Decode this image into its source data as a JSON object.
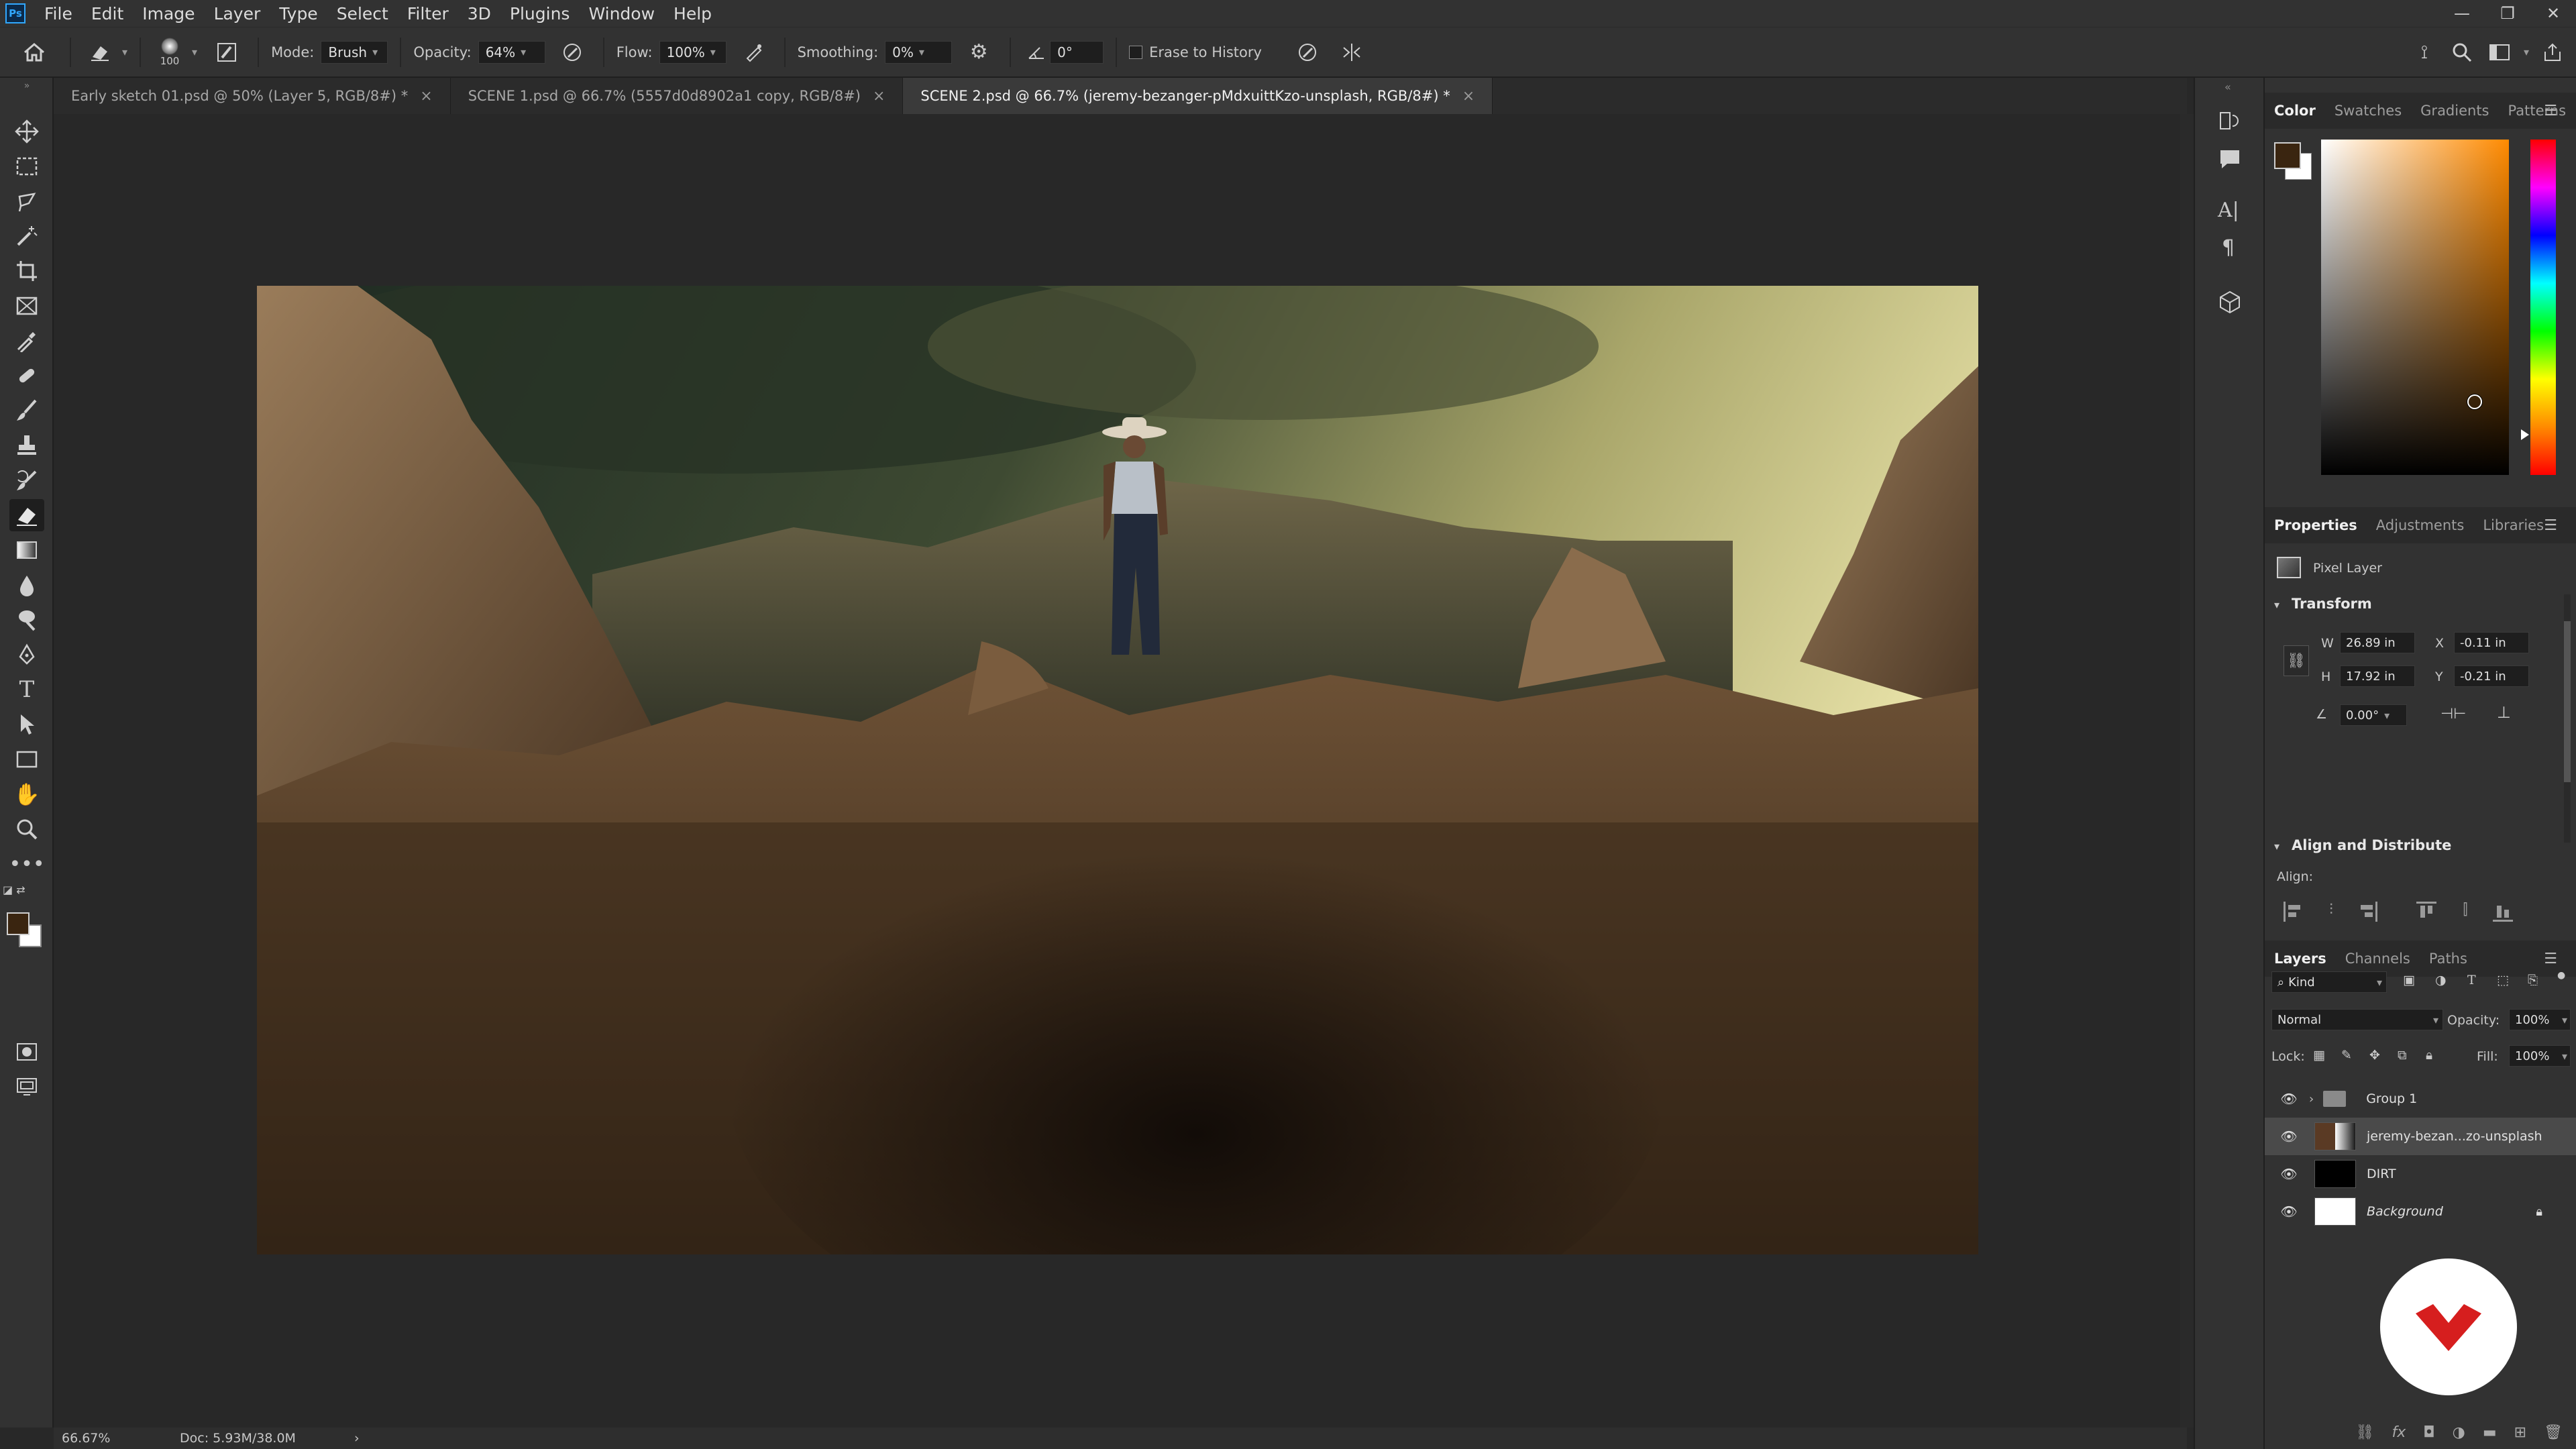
{
  "menubar": {
    "app_icon": "Ps",
    "items": [
      "File",
      "Edit",
      "Image",
      "Layer",
      "Type",
      "Select",
      "Filter",
      "3D",
      "Plugins",
      "Window",
      "Help"
    ],
    "window_controls": [
      "minimize-icon",
      "restore-icon",
      "close-icon"
    ]
  },
  "options": {
    "brush_size": "100",
    "mode_label": "Mode:",
    "mode_value": "Brush",
    "opacity_label": "Opacity:",
    "opacity_value": "64%",
    "flow_label": "Flow:",
    "flow_value": "100%",
    "smoothing_label": "Smoothing:",
    "smoothing_value": "0%",
    "angle_value": "0°",
    "erase_history_label": "Erase to History"
  },
  "tabs": [
    {
      "label": "Early sketch 01.psd @ 50% (Layer 5, RGB/8#) *",
      "active": false
    },
    {
      "label": "SCENE 1.psd @ 66.7% (5557d0d8902a1 copy, RGB/8#)",
      "active": false
    },
    {
      "label": "SCENE 2.psd @ 66.7% (jeremy-bezanger-pMdxuittKzo-unsplash, RGB/8#) *",
      "active": true
    }
  ],
  "status": {
    "zoom": "66.67%",
    "doc": "Doc: 5.93M/38.0M",
    "arrow": "›"
  },
  "color_panel": {
    "tabs": [
      "Color",
      "Swatches",
      "Gradients",
      "Patterns"
    ],
    "foreground": "#3a2510",
    "background": "#ffffff",
    "hue_color": "#ff8a00"
  },
  "properties_panel": {
    "tabs": [
      "Properties",
      "Adjustments",
      "Libraries"
    ],
    "layer_type": "Pixel Layer",
    "transform_title": "Transform",
    "w_label": "W",
    "w_value": "26.89 in",
    "h_label": "H",
    "h_value": "17.92 in",
    "x_label": "X",
    "x_value": "-0.11 in",
    "y_label": "Y",
    "y_value": "-0.21 in",
    "angle_value": "0.00°",
    "align_title": "Align and Distribute",
    "align_label": "Align:",
    "more": "..."
  },
  "layers_panel": {
    "tabs": [
      "Layers",
      "Channels",
      "Paths"
    ],
    "filter_kind": "Kind",
    "blend_mode": "Normal",
    "opacity_label": "Opacity:",
    "opacity_value": "100%",
    "lock_label": "Lock:",
    "fill_label": "Fill:",
    "fill_value": "100%",
    "layers": [
      {
        "name": "Group 1",
        "type": "group"
      },
      {
        "name": "jeremy-bezan...zo-unsplash",
        "type": "pixel",
        "selected": true
      },
      {
        "name": "DIRT",
        "type": "pixel"
      },
      {
        "name": "Background",
        "type": "background"
      }
    ]
  }
}
